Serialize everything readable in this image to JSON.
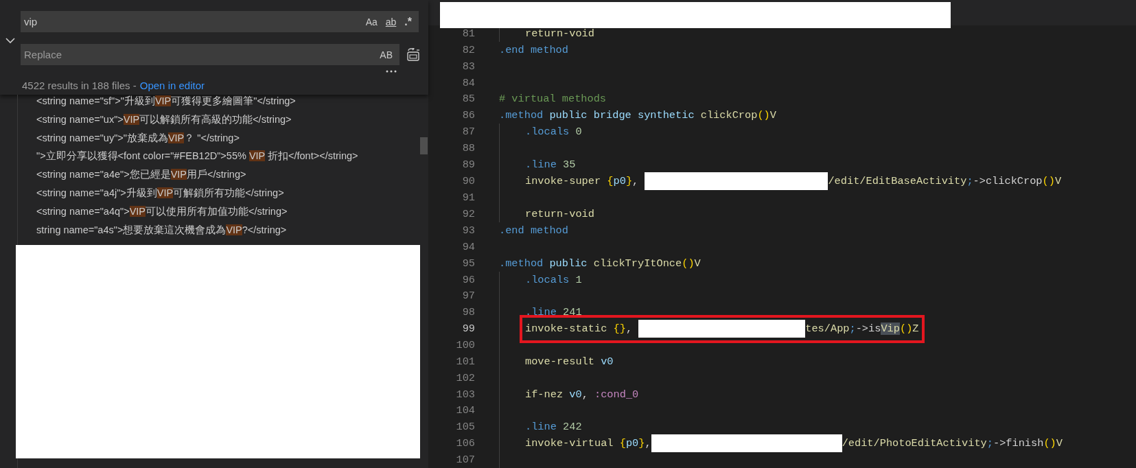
{
  "search": {
    "query": "vip",
    "toggles": [
      {
        "label": "Aa",
        "kind": "case",
        "on": false
      },
      {
        "label": "ab",
        "kind": "word",
        "on": false
      },
      {
        "label": ".*",
        "kind": "regex",
        "on": false
      }
    ],
    "replace_placeholder": "Replace",
    "preserve_case": {
      "label": "AB",
      "on": false
    },
    "summary": "4522 results in 188 files -",
    "open_link": "Open in editor"
  },
  "results": [
    {
      "segments": [
        {
          "text": "<string name=\"sf\">\"升級到",
          "match": false
        },
        {
          "text": "VIP",
          "match": true
        },
        {
          "text": "可獲得更多繪圖筆\"</string>",
          "match": false
        }
      ]
    },
    {
      "segments": [
        {
          "text": "<string name=\"ux\">",
          "match": false
        },
        {
          "text": "VIP",
          "match": true
        },
        {
          "text": "可以解鎖所有高級的功能</string>",
          "match": false
        }
      ]
    },
    {
      "segments": [
        {
          "text": "<string name=\"uy\">\"放棄成為",
          "match": false
        },
        {
          "text": "VIP",
          "match": true
        },
        {
          "text": "？ \"</string>",
          "match": false
        }
      ]
    },
    {
      "segments": [
        {
          "text": "\">立即分享以獲得<font color=\"#FEB12D\">55% ",
          "match": false
        },
        {
          "text": "VIP",
          "match": true
        },
        {
          "text": " 折扣</font></string>",
          "match": false
        }
      ]
    },
    {
      "segments": [
        {
          "text": "<string name=\"a4e\">您已經是",
          "match": false
        },
        {
          "text": "VIP",
          "match": true
        },
        {
          "text": "用戶</string>",
          "match": false
        }
      ]
    },
    {
      "segments": [
        {
          "text": "<string name=\"a4j\">升級到",
          "match": false
        },
        {
          "text": "VIP",
          "match": true
        },
        {
          "text": "可解鎖所有功能</string>",
          "match": false
        }
      ]
    },
    {
      "segments": [
        {
          "text": "<string name=\"a4q\">",
          "match": false
        },
        {
          "text": "VIP",
          "match": true
        },
        {
          "text": "可以使用所有加值功能</string>",
          "match": false
        }
      ]
    },
    {
      "segments": [
        {
          "text": "string name=\"a4s\">想要放棄這次機會成為",
          "match": false
        },
        {
          "text": "VIP",
          "match": true
        },
        {
          "text": "?</string>",
          "match": false
        }
      ]
    }
  ],
  "editor": {
    "lines": [
      {
        "number": "81",
        "indented": true,
        "current": false,
        "boxed": false,
        "tokens": [
          {
            "text": "return-void",
            "kind": "instruction"
          }
        ]
      },
      {
        "number": "82",
        "indented": false,
        "current": false,
        "boxed": false,
        "tokens": [
          {
            "text": ".end method",
            "kind": "directive"
          }
        ]
      },
      {
        "number": "83",
        "indented": false,
        "current": false,
        "boxed": false
      },
      {
        "number": "84",
        "indented": false,
        "current": false,
        "boxed": false
      },
      {
        "number": "85",
        "indented": false,
        "current": false,
        "boxed": false,
        "tokens": [
          {
            "text": "# virtual methods",
            "kind": "comment"
          }
        ]
      },
      {
        "number": "86",
        "indented": false,
        "current": false,
        "boxed": false,
        "tokens": [
          {
            "text": ".method",
            "kind": "directive"
          },
          {
            "text": " public bridge synthetic",
            "kind": "keyword"
          },
          {
            "text": " clickCrop",
            "kind": "function"
          },
          {
            "text": "()",
            "kind": "bracket"
          },
          {
            "text": "V",
            "kind": "function"
          }
        ]
      },
      {
        "number": "87",
        "indented": true,
        "current": false,
        "boxed": false,
        "tokens": [
          {
            "text": ".locals",
            "kind": "directive"
          },
          {
            "text": " 0",
            "kind": "number"
          }
        ]
      },
      {
        "number": "88",
        "indented": true,
        "current": false,
        "boxed": false
      },
      {
        "number": "89",
        "indented": true,
        "current": false,
        "boxed": false,
        "tokens": [
          {
            "text": ".line",
            "kind": "directive"
          },
          {
            "text": " 35",
            "kind": "number"
          }
        ]
      },
      {
        "number": "90",
        "indented": true,
        "current": false,
        "boxed": false,
        "tokens": [
          {
            "text": "invoke-super ",
            "kind": "instruction"
          },
          {
            "text": "{",
            "kind": "bracket"
          },
          {
            "text": "p0",
            "kind": "register"
          },
          {
            "text": "}",
            "kind": "bracket"
          },
          {
            "text": ", ",
            "kind": "plain"
          },
          {
            "kind": "redaction"
          },
          {
            "text": "/edit/EditBaseActivity",
            "kind": "function"
          },
          {
            "text": ";",
            "kind": "directive"
          },
          {
            "text": "->clickCrop",
            "kind": "plain"
          },
          {
            "text": "()",
            "kind": "bracket"
          },
          {
            "text": "V",
            "kind": "function"
          }
        ]
      },
      {
        "number": "91",
        "indented": true,
        "current": false,
        "boxed": false
      },
      {
        "number": "92",
        "indented": true,
        "current": false,
        "boxed": false,
        "tokens": [
          {
            "text": "return-void",
            "kind": "instruction"
          }
        ]
      },
      {
        "number": "93",
        "indented": false,
        "current": false,
        "boxed": false,
        "tokens": [
          {
            "text": ".end method",
            "kind": "directive"
          }
        ]
      },
      {
        "number": "94",
        "indented": false,
        "current": false,
        "boxed": false
      },
      {
        "number": "95",
        "indented": false,
        "current": false,
        "boxed": false,
        "tokens": [
          {
            "text": ".method",
            "kind": "directive"
          },
          {
            "text": " public",
            "kind": "keyword"
          },
          {
            "text": " clickTryItOnce",
            "kind": "function"
          },
          {
            "text": "()",
            "kind": "bracket"
          },
          {
            "text": "V",
            "kind": "function"
          }
        ]
      },
      {
        "number": "96",
        "indented": true,
        "current": false,
        "boxed": false,
        "tokens": [
          {
            "text": ".locals",
            "kind": "directive"
          },
          {
            "text": " 1",
            "kind": "number"
          }
        ]
      },
      {
        "number": "97",
        "indented": true,
        "current": false,
        "boxed": false
      },
      {
        "number": "98",
        "indented": true,
        "current": false,
        "boxed": false,
        "tokens": [
          {
            "text": ".line",
            "kind": "directive"
          },
          {
            "text": " 241",
            "kind": "number"
          }
        ]
      },
      {
        "number": "99",
        "indented": true,
        "current": true,
        "boxed": true,
        "tokens": [
          {
            "text": "invoke-static ",
            "kind": "instruction"
          },
          {
            "text": "{}",
            "kind": "bracket"
          },
          {
            "text": ", ",
            "kind": "plain"
          },
          {
            "kind": "redaction"
          },
          {
            "text": "tes/App",
            "kind": "function"
          },
          {
            "text": ";",
            "kind": "directive"
          },
          {
            "text": "->is",
            "kind": "plain"
          },
          {
            "text": "Vip",
            "kind": "match"
          },
          {
            "text": "()",
            "kind": "bracket"
          },
          {
            "text": "Z",
            "kind": "function"
          }
        ]
      },
      {
        "number": "100",
        "indented": true,
        "current": false,
        "boxed": false
      },
      {
        "number": "101",
        "indented": true,
        "current": false,
        "boxed": false,
        "tokens": [
          {
            "text": "move-result ",
            "kind": "instruction"
          },
          {
            "text": "v0",
            "kind": "register"
          }
        ]
      },
      {
        "number": "102",
        "indented": true,
        "current": false,
        "boxed": false
      },
      {
        "number": "103",
        "indented": true,
        "current": false,
        "boxed": false,
        "tokens": [
          {
            "text": "if-nez ",
            "kind": "instruction"
          },
          {
            "text": "v0",
            "kind": "register"
          },
          {
            "text": ", ",
            "kind": "plain"
          },
          {
            "text": ":cond_0",
            "kind": "label"
          }
        ]
      },
      {
        "number": "104",
        "indented": true,
        "current": false,
        "boxed": false
      },
      {
        "number": "105",
        "indented": true,
        "current": false,
        "boxed": false,
        "tokens": [
          {
            "text": ".line",
            "kind": "directive"
          },
          {
            "text": " 242",
            "kind": "number"
          }
        ]
      },
      {
        "number": "106",
        "indented": true,
        "current": false,
        "boxed": false,
        "tokens": [
          {
            "text": "invoke-virtual ",
            "kind": "instruction"
          },
          {
            "text": "{",
            "kind": "bracket"
          },
          {
            "text": "p0",
            "kind": "register"
          },
          {
            "text": "}",
            "kind": "bracket"
          },
          {
            "text": ",",
            "kind": "plain"
          },
          {
            "kind": "redaction"
          },
          {
            "text": "/edit/PhotoEditActivity",
            "kind": "function"
          },
          {
            "text": ";",
            "kind": "directive"
          },
          {
            "text": "->finish",
            "kind": "plain"
          },
          {
            "text": "()",
            "kind": "bracket"
          },
          {
            "text": "V",
            "kind": "function"
          }
        ]
      },
      {
        "number": "107",
        "indented": true,
        "current": false,
        "boxed": false
      }
    ]
  }
}
